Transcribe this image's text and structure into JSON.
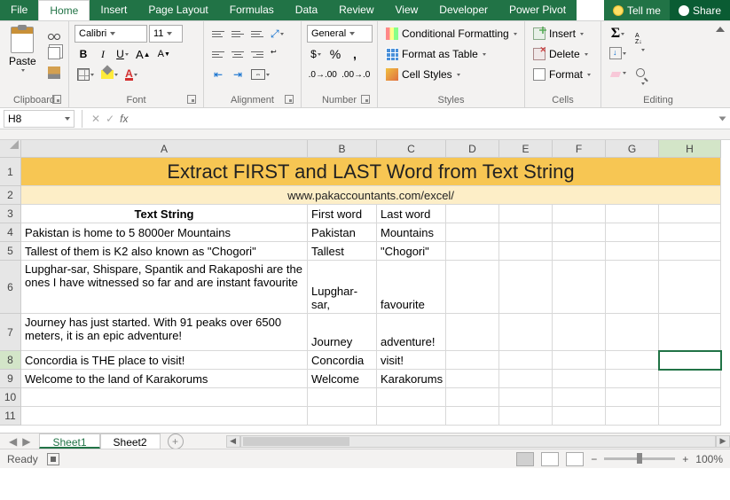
{
  "tabs": {
    "file": "File",
    "home": "Home",
    "insert": "Insert",
    "pagelayout": "Page Layout",
    "formulas": "Formulas",
    "data": "Data",
    "review": "Review",
    "view": "View",
    "developer": "Developer",
    "powerpivot": "Power Pivot",
    "tellme": "Tell me",
    "share": "Share"
  },
  "ribbon": {
    "clipboard": {
      "label": "Clipboard",
      "paste": "Paste"
    },
    "font": {
      "label": "Font",
      "name": "Calibri",
      "size": "11"
    },
    "alignment": {
      "label": "Alignment"
    },
    "number": {
      "label": "Number",
      "format": "General"
    },
    "styles": {
      "label": "Styles",
      "cond": "Conditional Formatting",
      "table": "Format as Table",
      "cell": "Cell Styles"
    },
    "cells": {
      "label": "Cells",
      "insert": "Insert",
      "delete": "Delete",
      "format": "Format"
    },
    "editing": {
      "label": "Editing"
    }
  },
  "namebox": "H8",
  "formula": "",
  "columns": [
    "A",
    "B",
    "C",
    "D",
    "E",
    "F",
    "G",
    "H"
  ],
  "rows": [
    "1",
    "2",
    "3",
    "4",
    "5",
    "6",
    "7",
    "8",
    "9",
    "10",
    "11"
  ],
  "selected_row": "8",
  "selected_col": "H",
  "data": {
    "title": "Extract FIRST and LAST Word from Text String",
    "subtitle": "www.pakaccountants.com/excel/",
    "headers": {
      "a": "Text String",
      "b": "First word",
      "c": "Last word"
    },
    "r4": {
      "a": "Pakistan is home to 5 8000er Mountains",
      "b": "Pakistan",
      "c": "Mountains"
    },
    "r5": {
      "a": "Tallest of them is K2 also known as \"Chogori\"",
      "b": "Tallest",
      "c": "\"Chogori\""
    },
    "r6": {
      "a": "Lupghar-sar, Shispare, Spantik and Rakaposhi are the ones I have witnessed so far and are instant favourite",
      "b": "Lupghar-sar,",
      "c": "favourite"
    },
    "r7": {
      "a": "Journey has just started. With 91 peaks over 6500 meters, it is an epic adventure!",
      "b": "Journey",
      "c": "adventure!"
    },
    "r8": {
      "a": "Concordia is THE place to visit!",
      "b": "Concordia",
      "c": "visit!"
    },
    "r9": {
      "a": "Welcome to the land of Karakorums",
      "b": "Welcome",
      "c": "Karakorums"
    }
  },
  "sheets": {
    "s1": "Sheet1",
    "s2": "Sheet2"
  },
  "status": {
    "ready": "Ready",
    "zoom": "100%"
  }
}
